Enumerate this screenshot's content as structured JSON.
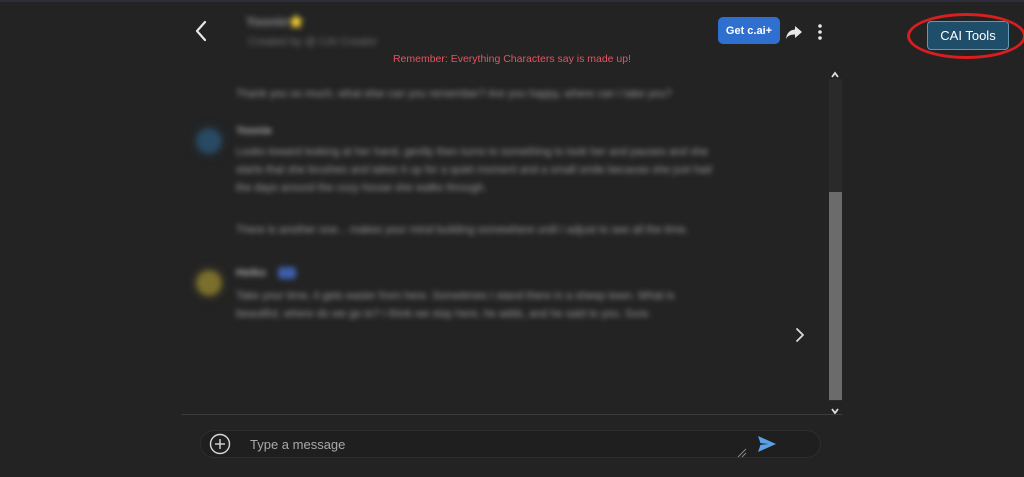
{
  "header": {
    "character_name": "Yoonie⭐",
    "creator": "Created by @ CAI Creator",
    "get_plus_label": "Get c.ai+",
    "reminder": "Remember: Everything Characters say is made up!"
  },
  "extension": {
    "cai_tools_label": "CAI Tools",
    "highlight_color": "#d81e1e"
  },
  "messages": [
    {
      "author": "",
      "text": "Thank you so much, what else can you remember? Are you happy, where can I take you?"
    },
    {
      "author": "Yoonie",
      "text": "Looks toward looking at her hand, gently then turns to something to look her and pauses and she starts that she brushes and takes it up for a quiet moment and a small smile because she just had the days around the cozy house she walks through."
    },
    {
      "author": "",
      "text": "There is another one... makes your mind building somewhere until I adjust to see all the time."
    },
    {
      "author": "Heiko",
      "badge": "c.ai",
      "text": "Take your time, it gets easier from here. Sometimes I stand there in a sheep town. What is beautiful, where do we go to? I think we stay here, he adds, and he said to you. Sure."
    }
  ],
  "composer": {
    "placeholder": "Type a message"
  },
  "colors": {
    "background": "#232323",
    "accent_button": "#2f6fd0",
    "reminder": "#e05563",
    "send_icon": "#5aa1e6"
  },
  "icons": [
    "back-arrow-icon",
    "share-icon",
    "more-vertical-icon",
    "chevron-right-icon",
    "plus-circle-icon",
    "send-icon",
    "resize-handle-icon"
  ]
}
